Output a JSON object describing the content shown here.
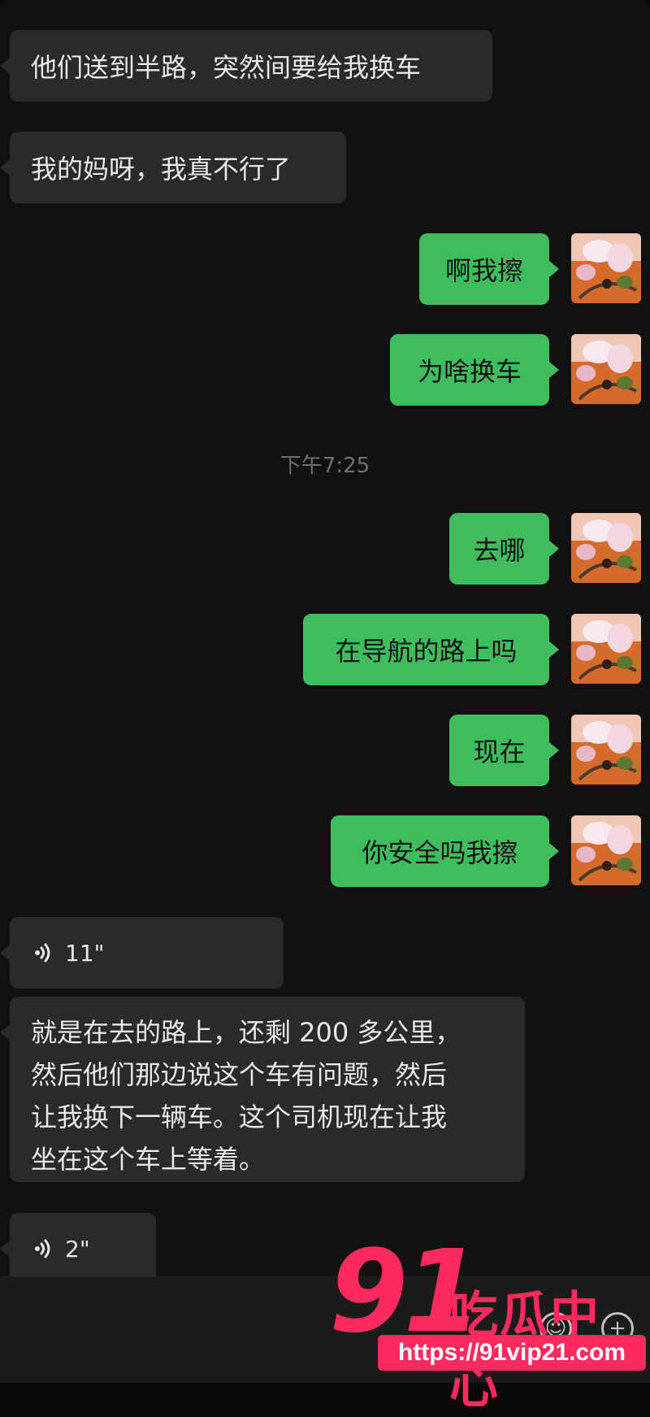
{
  "colors": {
    "background": "#111111",
    "bubble_incoming": "#2a2a2a",
    "bubble_outgoing": "#3fbd5e",
    "timestamp": "#6f6f6f",
    "watermark": "#ff2b5e"
  },
  "messages": {
    "m1": "他们送到半路，突然间要给我换车",
    "m2": "我的妈呀，我真不行了",
    "m3": "啊我擦",
    "m4": "为啥换车",
    "timestamp": "下午7:25",
    "m5": "去哪",
    "m6": "在导航的路上吗",
    "m7": "现在",
    "m8": "你安全吗我擦",
    "voice1_duration": "11\"",
    "transcript_lines": [
      "就是在去的路上，还剩 200 多公里，",
      "然后他们那边说这个车有问题，然后",
      "让我换下一辆车。这个司机现在让我",
      "坐在这个车上等着。"
    ],
    "voice2_duration": "2\""
  },
  "watermark": {
    "number": "91",
    "name": "吃瓜中心",
    "url": "https://91vip21.com"
  },
  "icons": {
    "voice": "voice-wave-icon",
    "avatar": "flower-avatar-image"
  }
}
